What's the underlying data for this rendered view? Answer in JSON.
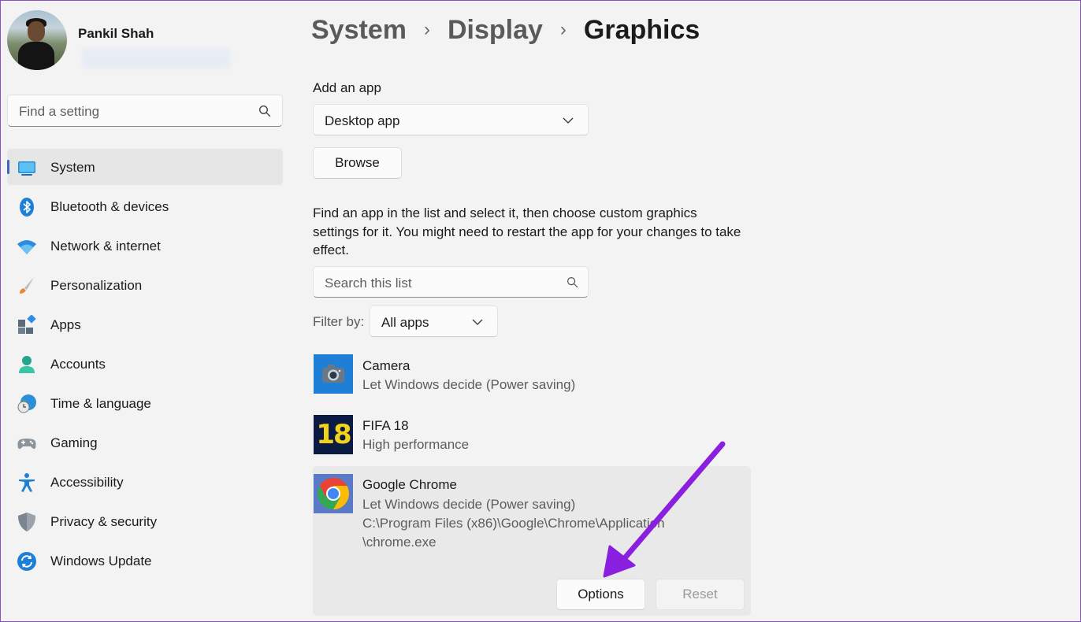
{
  "profile": {
    "name": "Pankil Shah"
  },
  "search": {
    "placeholder": "Find a setting"
  },
  "sidebar": {
    "items": [
      {
        "label": "System",
        "icon": "system-icon",
        "active": true
      },
      {
        "label": "Bluetooth & devices",
        "icon": "bluetooth-icon"
      },
      {
        "label": "Network & internet",
        "icon": "wifi-icon"
      },
      {
        "label": "Personalization",
        "icon": "brush-icon"
      },
      {
        "label": "Apps",
        "icon": "apps-icon"
      },
      {
        "label": "Accounts",
        "icon": "person-icon"
      },
      {
        "label": "Time & language",
        "icon": "globe-clock-icon"
      },
      {
        "label": "Gaming",
        "icon": "gamepad-icon"
      },
      {
        "label": "Accessibility",
        "icon": "accessibility-icon"
      },
      {
        "label": "Privacy & security",
        "icon": "shield-icon"
      },
      {
        "label": "Windows Update",
        "icon": "update-icon"
      }
    ]
  },
  "breadcrumb": {
    "items": [
      "System",
      "Display",
      "Graphics"
    ],
    "separator": "›"
  },
  "add_app": {
    "label": "Add an app",
    "type_value": "Desktop app",
    "browse_label": "Browse"
  },
  "instructions": "Find an app in the list and select it, then choose custom graphics settings for it. You might need to restart the app for your changes to take effect.",
  "list_search": {
    "placeholder": "Search this list"
  },
  "filter": {
    "label": "Filter by:",
    "value": "All apps"
  },
  "apps": [
    {
      "name": "Camera",
      "preference": "Let Windows decide (Power saving)",
      "icon": "camera-icon"
    },
    {
      "name": "FIFA 18",
      "preference": "High performance",
      "icon": "fifa-18-icon",
      "icon_text": "18"
    },
    {
      "name": "Google Chrome",
      "preference": "Let Windows decide (Power saving)",
      "path_line1": "C:\\Program Files (x86)\\Google\\Chrome\\Application",
      "path_line2": "\\chrome.exe",
      "icon": "chrome-icon",
      "selected": true
    }
  ],
  "actions": {
    "options_label": "Options",
    "reset_label": "Reset"
  },
  "colors": {
    "accent": "#4163b8",
    "annotation_arrow": "#8a1fe0"
  }
}
